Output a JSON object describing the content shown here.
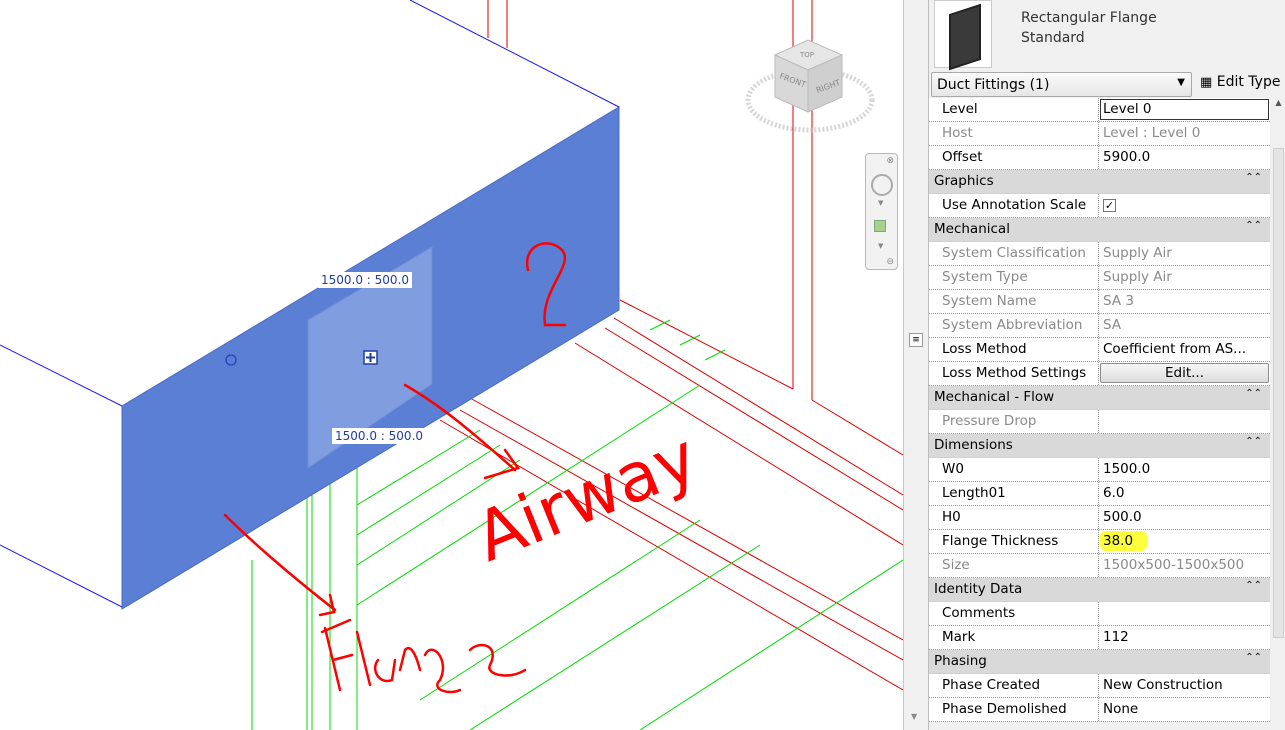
{
  "viewport": {
    "dim_top": "1500.0  : 500.0",
    "dim_bottom": "1500.0  : 500.0",
    "viewcube": {
      "top": "TOP",
      "front": "FRONT",
      "right": "RIGHT"
    },
    "annotations": {
      "question_mark": "?",
      "airway": "Airway",
      "flange": "Flange",
      "question_mark_2": "?"
    },
    "colors": {
      "duct_face": "#5b7fd4",
      "flange_face": "#7f9ddf",
      "duct_edge": "#1a1aff",
      "red_lines": "#e00000",
      "green_lines": "#00dd00",
      "annotation": "#ff0000"
    }
  },
  "properties": {
    "type_name_line1": "Rectangular Flange",
    "type_name_line2": "Standard",
    "selector": "Duct Fittings (1)",
    "edit_type": "Edit Type",
    "rows": [
      {
        "kind": "row",
        "label": "Level",
        "value": "Level 0",
        "active": true
      },
      {
        "kind": "row",
        "label": "Host",
        "value": "Level : Level 0",
        "readonly": true
      },
      {
        "kind": "row",
        "label": "Offset",
        "value": "5900.0"
      },
      {
        "kind": "header",
        "label": "Graphics"
      },
      {
        "kind": "row",
        "label": "Use Annotation Scale",
        "value": "",
        "checkbox": true
      },
      {
        "kind": "header",
        "label": "Mechanical"
      },
      {
        "kind": "row",
        "label": "System Classification",
        "value": "Supply Air",
        "readonly": true
      },
      {
        "kind": "row",
        "label": "System Type",
        "value": "Supply Air",
        "readonly": true
      },
      {
        "kind": "row",
        "label": "System Name",
        "value": "SA 3",
        "readonly": true
      },
      {
        "kind": "row",
        "label": "System Abbreviation",
        "value": "SA",
        "readonly": true
      },
      {
        "kind": "row",
        "label": "Loss Method",
        "value": "Coefficient from AS..."
      },
      {
        "kind": "row",
        "label": "Loss Method Settings",
        "value": "Edit...",
        "button": true
      },
      {
        "kind": "header",
        "label": "Mechanical - Flow"
      },
      {
        "kind": "row",
        "label": "Pressure Drop",
        "value": "",
        "readonly": true
      },
      {
        "kind": "header",
        "label": "Dimensions"
      },
      {
        "kind": "row",
        "label": "W0",
        "value": "1500.0"
      },
      {
        "kind": "row",
        "label": "Length01",
        "value": "6.0"
      },
      {
        "kind": "row",
        "label": "H0",
        "value": "500.0"
      },
      {
        "kind": "row",
        "label": "Flange Thickness",
        "value": "38.0",
        "highlight": true
      },
      {
        "kind": "row",
        "label": "Size",
        "value": "1500x500-1500x500",
        "readonly": true
      },
      {
        "kind": "header",
        "label": "Identity Data"
      },
      {
        "kind": "row",
        "label": "Comments",
        "value": ""
      },
      {
        "kind": "row",
        "label": "Mark",
        "value": "112"
      },
      {
        "kind": "header",
        "label": "Phasing"
      },
      {
        "kind": "row",
        "label": "Phase Created",
        "value": "New Construction"
      },
      {
        "kind": "row",
        "label": "Phase Demolished",
        "value": "None"
      }
    ],
    "highlight_color": "#ffff3c"
  }
}
